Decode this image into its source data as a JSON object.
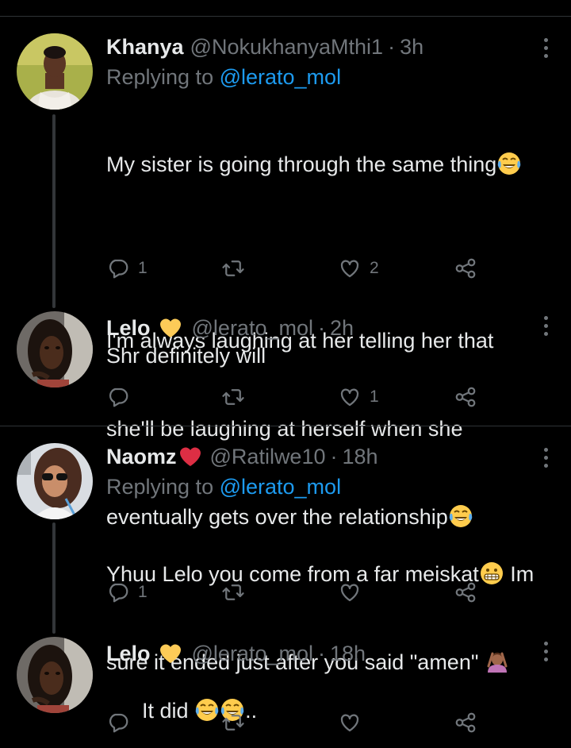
{
  "tweets": [
    {
      "name": "Khanya",
      "handle": "@NokukhanyaMthi1",
      "dot": "·",
      "time": "3h",
      "replying_prefix": "Replying to ",
      "replying_to": "@lerato_mol",
      "text_lines": [
        "My sister is going through the same thing",
        "",
        "I'm always laughing at her telling her that",
        "she'll be laughing at herself when she",
        "eventually gets over the relationship"
      ],
      "reply_count": "1",
      "retweet_count": "",
      "like_count": "2"
    },
    {
      "name": "Lelo",
      "handle": "@lerato_mol",
      "dot": "·",
      "time": "2h",
      "text": "Shr definitely will",
      "reply_count": "",
      "retweet_count": "",
      "like_count": "1"
    },
    {
      "name": "Naomz",
      "handle": "@Ratilwe10",
      "dot": "·",
      "time": "18h",
      "replying_prefix": "Replying to ",
      "replying_to": "@lerato_mol",
      "text_line1": "Yhuu Lelo you come from a far meiskat",
      "text_line1_end": " Im",
      "text_line2": "sure it ended just after you said \"amen\" ",
      "reply_count": "1",
      "retweet_count": "",
      "like_count": ""
    },
    {
      "name": "Lelo",
      "handle": "@lerato_mol",
      "dot": "·",
      "time": "18h",
      "text_start": "It did ",
      "text_end": "..",
      "reply_count": "",
      "retweet_count": "",
      "like_count": ""
    }
  ],
  "icons": {
    "reply": "reply-icon",
    "retweet": "retweet-icon",
    "like": "like-icon",
    "share": "share-icon",
    "more": "more-icon",
    "laughing": "tears-of-joy-emoji",
    "grimace": "grimacing-emoji",
    "facepalm": "person-gesturing-emoji",
    "yellow_heart": "yellow-heart-emoji",
    "red_heart": "red-heart-emoji"
  },
  "colors": {
    "background": "#000000",
    "text": "#e7e9ea",
    "muted": "#71767b",
    "link": "#1d9bf0",
    "divider": "#2f3336"
  }
}
